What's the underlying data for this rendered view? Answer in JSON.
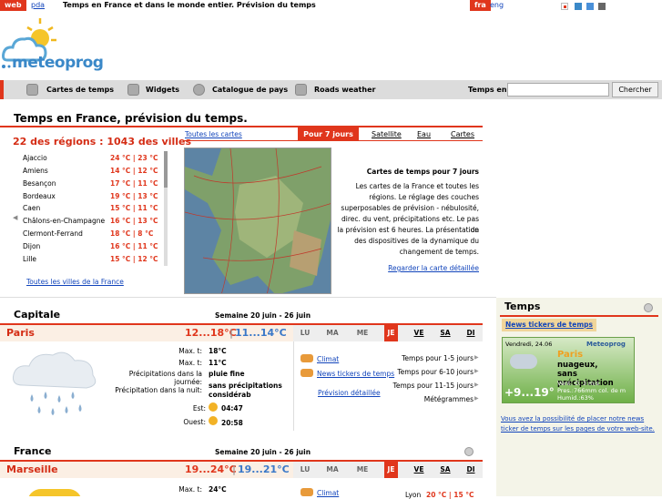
{
  "topbar": {
    "web": "web",
    "pda": "pda",
    "tagline": "Temps en France et dans le monde entier. Prévision du temps",
    "lang_fra": "fra",
    "lang_eng": "eng",
    "swatches": [
      "#ffffff",
      "#3a88c8",
      "#4a90d9",
      "#666666"
    ]
  },
  "logo": {
    "text": "meteoprog"
  },
  "nav": {
    "items": [
      {
        "label": "Cartes de temps",
        "icon": "map-icon"
      },
      {
        "label": "Widgets",
        "icon": "widget-icon"
      },
      {
        "label": "Catalogue de pays",
        "icon": "globe-icon"
      },
      {
        "label": "Roads weather",
        "icon": "car-icon"
      }
    ],
    "search_label": "Temps en:",
    "search_value": "",
    "search_button": "Chercher"
  },
  "page_title": "Temps en France, prévision du temps.",
  "regions": {
    "title": "22 des régions : 1043 des villes",
    "cities": [
      {
        "name": "Ajaccio",
        "temp": "24 °C | 23 °C"
      },
      {
        "name": "Amiens",
        "temp": "14 °C | 12 °C"
      },
      {
        "name": "Besançon",
        "temp": "17 °C | 11 °C"
      },
      {
        "name": "Bordeaux",
        "temp": "19 °C | 13 °C"
      },
      {
        "name": "Caen",
        "temp": "15 °C | 11 °C"
      },
      {
        "name": "Châlons-en-Champagne",
        "temp": "16 °C | 13 °C"
      },
      {
        "name": "Clermont-Ferrand",
        "temp": "18 °C |  8 °C"
      },
      {
        "name": "Dijon",
        "temp": "16 °C | 11 °C"
      },
      {
        "name": "Lille",
        "temp": "15 °C | 12 °C"
      }
    ],
    "all_link": "Toutes les villes de la France"
  },
  "maps": {
    "all_link": "Toutes les cartes",
    "tabs": [
      "Pour 7 jours",
      "Satellite",
      "Eau",
      "Cartes"
    ],
    "desc_title": "Cartes de temps pour 7 jours",
    "desc_text": [
      "Les cartes de la France et toutes les",
      "régions. Le réglage des couches",
      "superposables de prévision - nébulosité,",
      "direc. du vent, précipitations etc. Le pas de",
      "la prévision est 6 heures. La présentation",
      "des dispositives de la dynamique du",
      "changement de temps."
    ],
    "detail_link": "Regarder la carte détaillée"
  },
  "capitale": {
    "title": "Capitale",
    "week": "Semaine 20 juin - 26 juin",
    "city": "Paris",
    "temp_day": "12...18°C",
    "temp_night": "11...14°C",
    "details": [
      {
        "label": "Max. t:",
        "value": "18°C"
      },
      {
        "label": "Max. t:",
        "value": "11°C"
      },
      {
        "label": "Précipitations dans la journée:",
        "value": "pluie fine"
      },
      {
        "label": "Précipitation dans la nuit:",
        "value": "sans précipitations"
      },
      {
        "label": "",
        "value": "considérab"
      },
      {
        "label": "Est:",
        "value": "04:47"
      },
      {
        "label": "Ouest:",
        "value": "20:58"
      }
    ],
    "days": [
      "LU",
      "MA",
      "ME",
      "JE",
      "VE",
      "SA",
      "DI"
    ],
    "links": [
      "Climat",
      "News tickers de temps",
      "Prévision détaillée"
    ],
    "right_links": [
      "Temps pour 1-5 jours",
      "Temps pour 6-10 jours",
      "Temps pour 11-15 jours",
      "Métégrammes"
    ]
  },
  "france": {
    "title": "France",
    "week": "Semaine 20 juin - 26 juin",
    "city": "Marseille",
    "temp_day": "19...24°C",
    "temp_night": "19...21°C",
    "detail_label": "Max. t:",
    "detail_value": "24°C",
    "link": "Climat",
    "right_text": "Lyon",
    "right_temp": "20 °C | 15 °C"
  },
  "sidebar": {
    "title": "Temps",
    "ticker_button": "News tickers de temps",
    "widget": {
      "date": "Vendredi, 24.06",
      "brand": "Meteoprog",
      "city": "Paris",
      "cond1": "nuageux,",
      "cond2": "sans précipitation",
      "temp": "+9...19°",
      "wind": "Vent: O. 3 m/s",
      "pres": "Pres.:766mm col. de m",
      "humid": "Humid.:63%"
    },
    "promo": "Vous avez la possibilité de placer notre news ticker de temps sur les pages de votre web-site."
  }
}
